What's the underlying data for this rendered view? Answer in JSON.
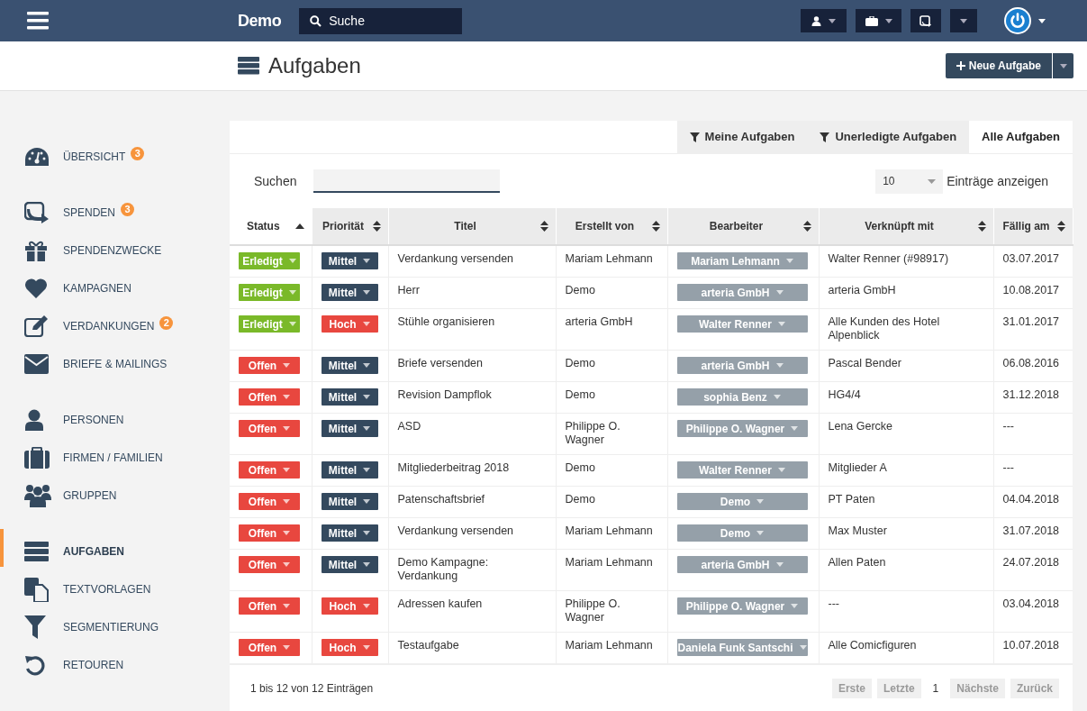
{
  "topbar": {
    "brand": "Demo",
    "search": {
      "placeholder": "Suche"
    }
  },
  "page": {
    "title": "Aufgaben",
    "new_button": "Neue Aufgabe"
  },
  "sidebar": {
    "groups": [
      [
        {
          "label": "ÜBERSICHT",
          "badge": "3",
          "selected": false
        }
      ],
      [
        {
          "label": "SPENDEN",
          "badge": "3",
          "selected": false
        },
        {
          "label": "SPENDENZWECKE",
          "selected": false
        },
        {
          "label": "KAMPAGNEN",
          "selected": false
        },
        {
          "label": "VERDANKUNGEN",
          "badge": "2",
          "selected": false
        },
        {
          "label": "BRIEFE & MAILINGS",
          "selected": false
        }
      ],
      [
        {
          "label": "PERSONEN",
          "selected": false
        },
        {
          "label": "FIRMEN / FAMILIEN",
          "selected": false
        },
        {
          "label": "GRUPPEN",
          "selected": false
        }
      ],
      [
        {
          "label": "AUFGABEN",
          "selected": true
        },
        {
          "label": "TEXTVORLAGEN",
          "selected": false
        },
        {
          "label": "SEGMENTIERUNG",
          "selected": false
        },
        {
          "label": "RETOUREN",
          "selected": false
        }
      ]
    ]
  },
  "tabs": [
    {
      "label": "Meine Aufgaben",
      "filter": true,
      "selected": false
    },
    {
      "label": "Unerledigte Aufgaben",
      "filter": true,
      "selected": false
    },
    {
      "label": "Alle Aufgaben",
      "filter": false,
      "selected": true
    }
  ],
  "search_label": "Suchen",
  "page_size": {
    "value": "10",
    "label": "Einträge anzeigen"
  },
  "table": {
    "columns": [
      {
        "label": "Status",
        "sorted": true
      },
      {
        "label": "Priorität",
        "sorted": false
      },
      {
        "label": "Titel",
        "sorted": false
      },
      {
        "label": "Erstellt von",
        "sorted": false
      },
      {
        "label": "Bearbeiter",
        "sorted": false
      },
      {
        "label": "Verknüpft mit",
        "sorted": false
      },
      {
        "label": "Fällig am",
        "sorted": false
      }
    ],
    "rows": [
      {
        "status": {
          "kind": "done",
          "label": "Erledigt"
        },
        "priority": {
          "kind": "medium",
          "label": "Mittel"
        },
        "title": "Verdankung versenden",
        "created_by": "Mariam Lehmann",
        "assignee": "Mariam Lehmann",
        "linked": "Walter Renner (#98917)",
        "due": "03.07.2017"
      },
      {
        "status": {
          "kind": "done",
          "label": "Erledigt"
        },
        "priority": {
          "kind": "medium",
          "label": "Mittel"
        },
        "title": "Herr",
        "created_by": "Demo",
        "assignee": "arteria GmbH",
        "linked": "arteria GmbH",
        "due": "10.08.2017"
      },
      {
        "status": {
          "kind": "done",
          "label": "Erledigt"
        },
        "priority": {
          "kind": "high",
          "label": "Hoch"
        },
        "title": "Stühle organisieren",
        "created_by": "arteria GmbH",
        "assignee": "Walter Renner",
        "linked": "Alle Kunden des Hotel Alpenblick",
        "due": "31.01.2017"
      },
      {
        "status": {
          "kind": "open",
          "label": "Offen"
        },
        "priority": {
          "kind": "medium",
          "label": "Mittel"
        },
        "title": "Briefe versenden",
        "created_by": "Demo",
        "assignee": "arteria GmbH",
        "linked": "Pascal Bender",
        "due": "06.08.2016"
      },
      {
        "status": {
          "kind": "open",
          "label": "Offen"
        },
        "priority": {
          "kind": "medium",
          "label": "Mittel"
        },
        "title": "Revision Dampflok",
        "created_by": "Demo",
        "assignee": "sophia Benz",
        "linked": "HG4/4",
        "due": "31.12.2018"
      },
      {
        "status": {
          "kind": "open",
          "label": "Offen"
        },
        "priority": {
          "kind": "medium",
          "label": "Mittel"
        },
        "title": "ASD",
        "created_by": "Philippe O. Wagner",
        "assignee": "Philippe O. Wagner",
        "linked": "Lena Gercke",
        "due": "---"
      },
      {
        "status": {
          "kind": "open",
          "label": "Offen"
        },
        "priority": {
          "kind": "medium",
          "label": "Mittel"
        },
        "title": "Mitgliederbeitrag 2018",
        "created_by": "Demo",
        "assignee": "Walter Renner",
        "linked": "Mitglieder A",
        "due": "---"
      },
      {
        "status": {
          "kind": "open",
          "label": "Offen"
        },
        "priority": {
          "kind": "medium",
          "label": "Mittel"
        },
        "title": "Patenschaftsbrief",
        "created_by": "Demo",
        "assignee": "Demo",
        "linked": "PT Paten",
        "due": "04.04.2018"
      },
      {
        "status": {
          "kind": "open",
          "label": "Offen"
        },
        "priority": {
          "kind": "medium",
          "label": "Mittel"
        },
        "title": "Verdankung versenden",
        "created_by": "Mariam Lehmann",
        "assignee": "Demo",
        "linked": "Max Muster",
        "due": "31.07.2018"
      },
      {
        "status": {
          "kind": "open",
          "label": "Offen"
        },
        "priority": {
          "kind": "medium",
          "label": "Mittel"
        },
        "title": "Demo Kampagne: Verdankung",
        "created_by": "Mariam Lehmann",
        "assignee": "arteria GmbH",
        "linked": "Allen Paten",
        "due": "24.07.2018"
      },
      {
        "status": {
          "kind": "open",
          "label": "Offen"
        },
        "priority": {
          "kind": "high",
          "label": "Hoch"
        },
        "title": "Adressen kaufen",
        "created_by": "Philippe O. Wagner",
        "assignee": "Philippe O. Wagner",
        "linked": "---",
        "due": "03.04.2018"
      },
      {
        "status": {
          "kind": "open",
          "label": "Offen"
        },
        "priority": {
          "kind": "high",
          "label": "Hoch"
        },
        "title": "Testaufgabe",
        "created_by": "Mariam Lehmann",
        "assignee": "Daniela Funk Santschi",
        "linked": "Alle Comicfiguren",
        "due": "10.07.2018"
      }
    ]
  },
  "info": "1 bis 12 von 12 Einträgen",
  "pagination": [
    {
      "label": "Erste",
      "disabled": true
    },
    {
      "label": "Letzte",
      "disabled": true
    },
    {
      "label": "1",
      "disabled": false
    },
    {
      "label": "Nächste",
      "disabled": true
    },
    {
      "label": "Zurück",
      "disabled": true
    }
  ]
}
